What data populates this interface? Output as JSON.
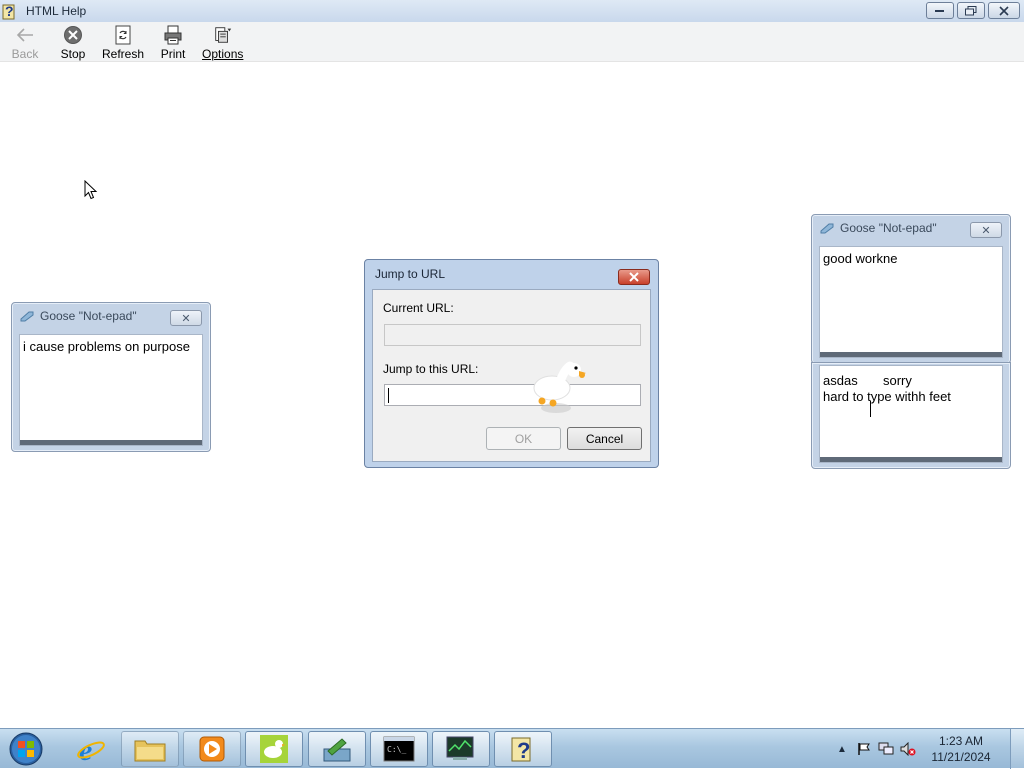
{
  "window": {
    "title": "HTML Help",
    "controls": {
      "minimize": "–",
      "restore": "❐",
      "close": "✕"
    }
  },
  "toolbar": {
    "back_label": "Back",
    "stop_label": "Stop",
    "refresh_label": "Refresh",
    "print_label": "Print",
    "options_label": "Options"
  },
  "goose_notes": [
    {
      "title": "Goose \"Not-epad\"",
      "text": "i cause problems on purpose"
    },
    {
      "title": "Goose \"Not-epad\"",
      "text": "good workne"
    },
    {
      "title": "",
      "text": "asdas       sorry\nhard to type withh feet"
    }
  ],
  "dialog": {
    "title": "Jump to URL",
    "current_url_label": "Current URL:",
    "current_url_value": "",
    "jump_label": "Jump to this URL:",
    "jump_value": "",
    "ok_label": "OK",
    "cancel_label": "Cancel"
  },
  "taskbar": {
    "apps": [
      "start-orb",
      "internet-explorer-icon",
      "explorer-folder-icon",
      "media-player-icon",
      "goose-app-icon",
      "download-manager-icon",
      "command-prompt-icon",
      "task-manager-icon",
      "html-help-icon"
    ],
    "clock_time": "1:23 AM",
    "clock_date": "11/21/2024"
  },
  "colors": {
    "accent": "#c4d3e6",
    "dialog_close": "#c8402b",
    "goose_orange": "#f5a623"
  }
}
